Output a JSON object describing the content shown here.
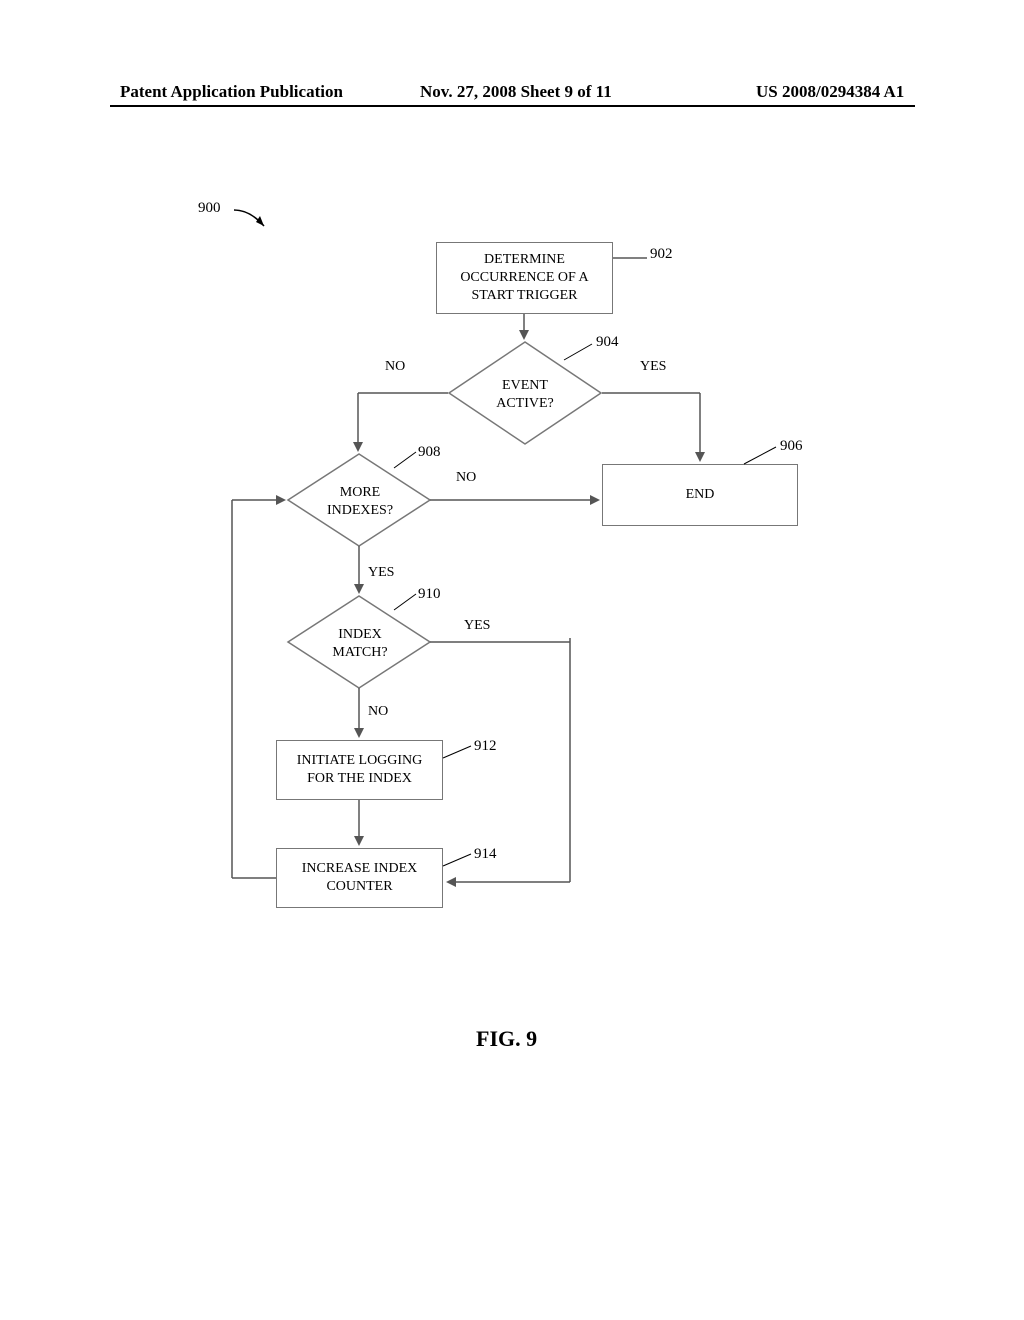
{
  "header": {
    "left": "Patent Application Publication",
    "center": "Nov. 27, 2008  Sheet 9 of 11",
    "right": "US 2008/0294384 A1"
  },
  "figure_caption": "FIG. 9",
  "ref_labels": {
    "r900": "900",
    "r902": "902",
    "r904": "904",
    "r906": "906",
    "r908": "908",
    "r910": "910",
    "r912": "912",
    "r914": "914"
  },
  "edge_labels": {
    "no1": "NO",
    "yes1": "YES",
    "no2": "NO",
    "yes2": "YES",
    "yes3": "YES",
    "no3": "NO"
  },
  "nodes": {
    "n902": "DETERMINE OCCURRENCE OF A START TRIGGER",
    "n904": "EVENT ACTIVE?",
    "n906": "END",
    "n908": "MORE INDEXES?",
    "n910": "INDEX MATCH?",
    "n912": "INITIATE LOGGING FOR THE INDEX",
    "n914": "INCREASE INDEX COUNTER"
  }
}
